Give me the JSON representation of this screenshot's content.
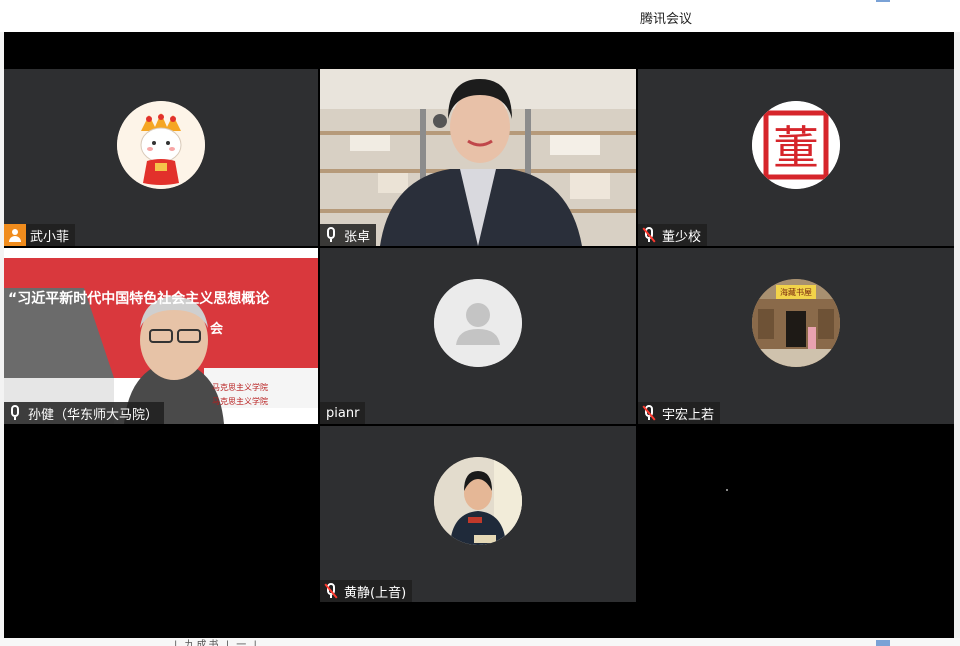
{
  "window": {
    "title": "腾讯会议"
  },
  "tiles": [
    {
      "name": "武小菲",
      "mic": "person-orange",
      "kind": "avatar-cartoon"
    },
    {
      "name": "张卓",
      "mic": "on",
      "kind": "video-woman"
    },
    {
      "name": "董少校",
      "mic": "muted",
      "kind": "avatar-seal"
    },
    {
      "name": "孙健（华东师大马院）",
      "mic": "on",
      "kind": "video-man",
      "banner_line1": "“习近平新时代中国特色社会主义思想概论",
      "banner_line2": "会",
      "banner_sub1": "马克思主义学院",
      "banner_sub2": "马克思主义学院"
    },
    {
      "name": "pianr",
      "mic": "none",
      "kind": "avatar-default"
    },
    {
      "name": "宇宏上若",
      "mic": "muted",
      "kind": "avatar-building",
      "plaque": "海藏书屋"
    },
    {
      "name": "黄静(上音)",
      "mic": "muted",
      "kind": "avatar-photo"
    }
  ],
  "seal_text": "董",
  "bottom_ghost_text": "| 九成书 | 一 |",
  "colors": {
    "tile_bg": "#2e2f31",
    "label_orange": "#f08c1d",
    "muted_red": "#ff3b30"
  },
  "icons": [
    "person-icon",
    "mic-icon",
    "mic-muted-icon",
    "default-avatar-icon"
  ]
}
